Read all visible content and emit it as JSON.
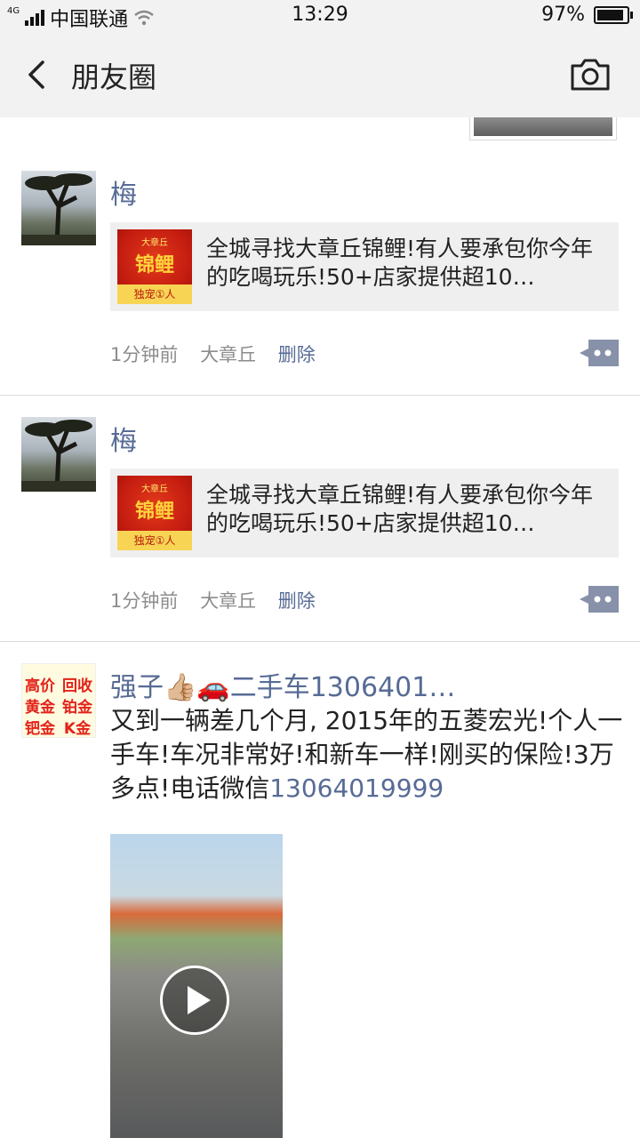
{
  "status_bar": {
    "network": "4G",
    "carrier": "中国联通",
    "time": "13:29",
    "battery": "97%",
    "battery_level": 0.97
  },
  "nav": {
    "back_icon": "chevron-left-icon",
    "title": "朋友圈",
    "camera_icon": "camera-icon"
  },
  "posts": [
    {
      "name": "梅",
      "card": {
        "thumb_top": "大章丘",
        "thumb_main": "锦鲤",
        "thumb_bottom": "独宠①人",
        "title": "全城寻找大章丘锦鲤!有人要承包你今年的吃喝玩乐!50+店家提供超10…"
      },
      "time": "1分钟前",
      "location": "大章丘",
      "delete_label": "删除"
    },
    {
      "name": "梅",
      "card": {
        "thumb_top": "大章丘",
        "thumb_main": "锦鲤",
        "thumb_bottom": "独宠①人",
        "title": "全城寻找大章丘锦鲤!有人要承包你今年的吃喝玩乐!50+店家提供超10…"
      },
      "time": "1分钟前",
      "location": "大章丘",
      "delete_label": "删除"
    },
    {
      "name": "强子👍🏼🚗二手车1306401…",
      "avatar_text": [
        "高价",
        "回收",
        "黄金",
        "铂金",
        "钯金",
        "K金"
      ],
      "text": "又到一辆差几个月, 2015年的五菱宏光!个人一手车!车况非常好!和新车一样!刚买的保险!3万多点!电话微信",
      "phone": "13064019999"
    }
  ]
}
